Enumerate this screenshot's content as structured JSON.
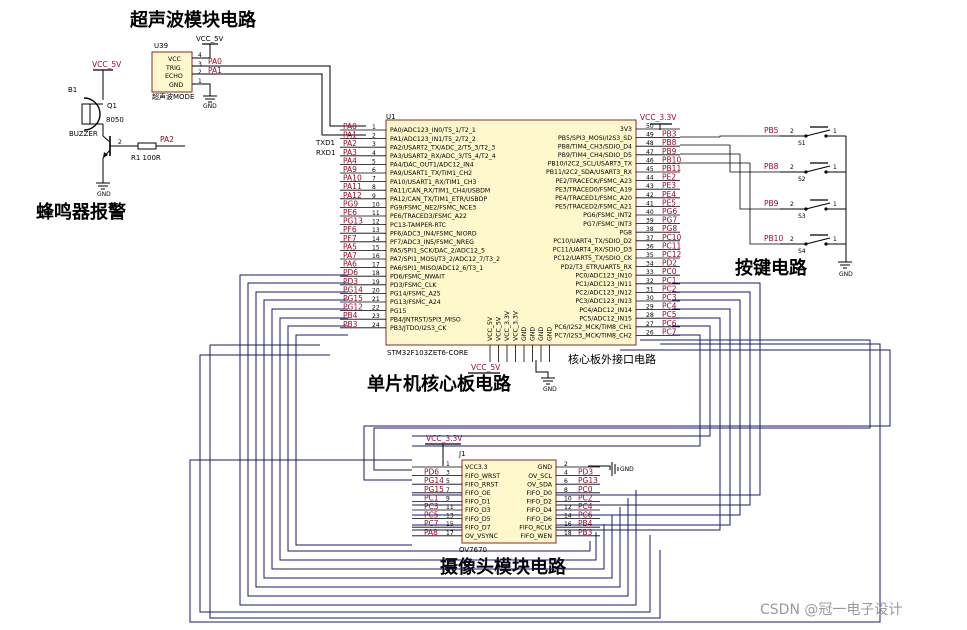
{
  "headings": {
    "ultrasonic": "超声波模块电路",
    "buzzer": "蜂鸣器报警",
    "keys": "按键电路",
    "mcu": "单片机核心板电路",
    "external_port": "核心板外接口电路",
    "camera": "摄像头模块电路"
  },
  "power": {
    "vcc5": "VCC_5V",
    "vcc33": "VCC_3.3V",
    "gnd": "GND",
    "gnd_ref": "GND"
  },
  "ultrasonic": {
    "designator": "U39",
    "pins": [
      "VCC",
      "TRIG",
      "ECHO",
      "GND"
    ],
    "pin_numbers": [
      "4",
      "3",
      "2",
      "1"
    ],
    "nets": [
      "PA0",
      "PA1"
    ],
    "mode_label": "超声波MODE"
  },
  "buzzer": {
    "designator": "B1",
    "name": "BUZZER",
    "transistor": "Q1",
    "transistor_type": "8050",
    "resistor": "R1 100R",
    "net": "PA2"
  },
  "mcu": {
    "designator": "U1",
    "part": "STM32F103ZET6-CORE",
    "tx_label": "TXD1",
    "rx_label": "RXD1",
    "left_nets": [
      "PA0",
      "PA1",
      "PA2",
      "PA3",
      "PA4",
      "PA9",
      "PA10",
      "PA11",
      "PA12",
      "PG9",
      "PE6",
      "PG13",
      "PF6",
      "PF7",
      "PA5",
      "PA7",
      "PA6",
      "PD6",
      "PD3",
      "PG14",
      "PG15",
      "PG12",
      "PB4",
      "PB3"
    ],
    "left_pins": [
      "PA0/ADC123_IN0/T5_1/T2_1",
      "PA1/ADC123_IN1/T5_2/T2_2",
      "PA2/USART2_TX/ADC_2/T5_3/T2_3",
      "PA3/USART2_RX/ADC_3/T5_4/T2_4",
      "PA4/DAC_OUT1/ADC12_IN4",
      "PA9/USART1_TX/TIM1_CH2",
      "PA10/USART1_RX/TIM1_CH3",
      "PA11/CAN_RX/TIM1_CH4/USBDM",
      "PA12/CAN_TX/TIM1_ETR/USBDP",
      "PG9/FSMC_NE2/FSMC_NCE3",
      "PE6/TRACED3/FSMC_A22",
      "PC13-TAMPER-RTC",
      "PF6/ADC3_IN4/FSMC_NIORD",
      "PF7/ADC3_IN5/FSMC_NREG",
      "PA5/SPI1_SCK/DAC_2/ADC12_5",
      "PA7/SPI1_MOSI/T3_2/ADC12_7/T3_2",
      "PA6/SPI1_MISO/ADC12_6/T3_1",
      "PD6/FSMC_NWAIT",
      "PD3/FSMC_CLK",
      "PG14/FSMC_A25",
      "PG13/FSMC_A24",
      "PG15",
      "PB4/JNTRST/SPI3_MISO",
      "PB3/JTDO/I2S3_CK"
    ],
    "left_numbers": [
      "1",
      "2",
      "3",
      "4",
      "5",
      "6",
      "7",
      "8",
      "9",
      "10",
      "11",
      "12",
      "13",
      "14",
      "15",
      "16",
      "17",
      "18",
      "19",
      "20",
      "21",
      "22",
      "23",
      "24"
    ],
    "right_nets": [
      "",
      "PB3",
      "PB8",
      "PB9",
      "PB10",
      "PB11",
      "PE2",
      "PE3",
      "PE4",
      "PE5",
      "PG6",
      "PG7",
      "PG8",
      "PC10",
      "PC11",
      "PC12",
      "PD2",
      "PC0",
      "PC1",
      "PC2",
      "PC3",
      "PC4",
      "PC5",
      "PC6",
      "PC7"
    ],
    "right_pins": [
      "3V3",
      "PB5/SPI3_MOSI/I2S3_SD",
      "PB8/TIM4_CH3/SDIO_D4",
      "PB9/TIM4_CH4/SDIO_D5",
      "PB10/I2C2_SCL/USART3_TX",
      "PB11/I2C2_SDA/USART3_RX",
      "PE2/TRACECK/FSMC_A23",
      "PE3/TRACED0/FSMC_A19",
      "PE4/TRACED1/FSMC_A20",
      "PE5/TRACED2/FSMC_A21",
      "PG6/FSMC_INT2",
      "PG7/FSMC_INT3",
      "PG8",
      "PC10/UART4_TX/SDIO_D2",
      "PC11/UART4_RX/SDIO_D3",
      "PC12/UART5_TX/SDIO_CK",
      "PD2/T3_ETR/UART5_RX",
      "PC0/ADC123_IN10",
      "PC1/ADC123_IN11",
      "PC2/ADC123_IN12",
      "PC3/ADC123_IN13",
      "PC4/ADC12_IN14",
      "PC5/ADC12_IN15",
      "PC6/I2S2_MCK/TIM8_CH1",
      "PC7/I2S3_MCK/TIM8_CH2"
    ],
    "right_numbers": [
      "50",
      "49",
      "48",
      "47",
      "46",
      "45",
      "44",
      "43",
      "42",
      "41",
      "40",
      "39",
      "38",
      "37",
      "36",
      "35",
      "34",
      "33",
      "32",
      "31",
      "30",
      "29",
      "28",
      "27",
      "26"
    ],
    "bottom_pins": [
      "VCC_5V",
      "VCC_5V",
      "VCC_3.3V",
      "VCC_3.3V",
      "GND",
      "GND",
      "GND",
      "GND"
    ]
  },
  "keys": {
    "switches": [
      {
        "net": "PB5",
        "name": "S1"
      },
      {
        "net": "PB8",
        "name": "S2"
      },
      {
        "net": "PB9",
        "name": "S3"
      },
      {
        "net": "PB10",
        "name": "S4"
      }
    ]
  },
  "camera": {
    "designator": "J1",
    "part": "OV7670",
    "left_pins": [
      "VCC3.3",
      "FIFO_WRST",
      "FIFO_RRST",
      "FIFO_OE",
      "FIFO_D1",
      "FIFO_D3",
      "FIFO_D5",
      "FIFO_D7",
      "OV_VSYNC"
    ],
    "left_numbers": [
      "1",
      "3",
      "5",
      "7",
      "9",
      "11",
      "13",
      "15",
      "17"
    ],
    "left_nets": [
      "",
      "PD6",
      "PG14",
      "PG15",
      "PC1",
      "PC3",
      "PC5",
      "PC7",
      "PA8"
    ],
    "right_pins": [
      "GND",
      "OV_SCL",
      "OV_SDA",
      "FIFO_D0",
      "FIFO_D2",
      "FIFO_D4",
      "FIFO_D6",
      "FIFO_RCLK",
      "FIFO_WEN"
    ],
    "right_numbers": [
      "2",
      "4",
      "6",
      "8",
      "10",
      "12",
      "14",
      "16",
      "18"
    ],
    "right_nets": [
      "",
      "PD3",
      "PG13",
      "PC0",
      "PC2",
      "PC4",
      "PC6",
      "PB4",
      "PB3"
    ]
  },
  "watermark": "CSDN @冠一电子设计"
}
